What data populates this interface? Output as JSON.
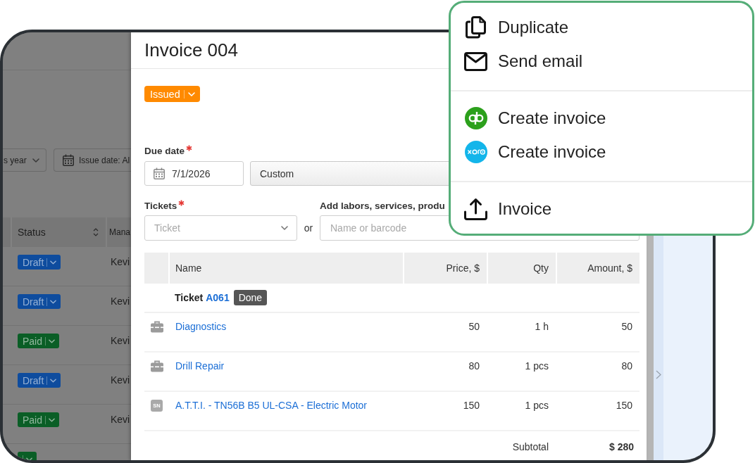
{
  "background_app": {
    "filters": [
      {
        "kind": "select",
        "label": "s year"
      },
      {
        "kind": "date",
        "label": "Issue date: Al"
      }
    ],
    "table": {
      "columns": [
        "Status",
        "Mana"
      ],
      "rows": [
        {
          "status": "Draft",
          "color": "#0e4c9e",
          "manager": "Kevi"
        },
        {
          "status": "Draft",
          "color": "#0e4c9e",
          "manager": "Kevi"
        },
        {
          "status": "Paid",
          "color": "#0a5e26",
          "manager": "Kevi"
        },
        {
          "status": "Draft",
          "color": "#0e4c9e",
          "manager": "Kevi"
        },
        {
          "status": "Paid",
          "color": "#0a5e26",
          "manager": "Kevi"
        },
        {
          "color": "#0a5e26"
        }
      ]
    }
  },
  "invoice": {
    "title": "Invoice 004",
    "status": "Issued",
    "due_date": {
      "label": "Due date",
      "required": true,
      "value": "7/1/2026",
      "term": "Custom"
    },
    "tickets": {
      "label": "Tickets",
      "required": true,
      "placeholder": "Ticket"
    },
    "separator": "or",
    "item_search": {
      "label": "Add labors, services, produ",
      "placeholder": "Name or barcode"
    },
    "table": {
      "columns": [
        "Name",
        "Price, $",
        "Qty",
        "Amount, $"
      ],
      "group": {
        "label": "Ticket",
        "number": "A061",
        "status": "Done"
      },
      "rows": [
        {
          "kind": "service",
          "name": "Diagnostics",
          "price": "50",
          "qty": "1 h",
          "amount": "50"
        },
        {
          "kind": "service",
          "name": "Drill Repair",
          "price": "80",
          "qty": "1 pcs",
          "amount": "80"
        },
        {
          "kind": "serial",
          "tag": "SN",
          "name": "A.T.T.I. - TN56B B5 UL-CSA - Electric Motor",
          "price": "150",
          "qty": "1 pcs",
          "amount": "150"
        }
      ],
      "subtotal": {
        "label": "Subtotal",
        "value": "$ 280"
      }
    }
  },
  "menu": {
    "sections": [
      {
        "items": [
          {
            "kind": "copy",
            "label": "Duplicate"
          },
          {
            "kind": "mail",
            "label": "Send email"
          }
        ]
      },
      {
        "items": [
          {
            "kind": "qb",
            "label": "Create invoice"
          },
          {
            "kind": "xero",
            "label": "Create invoice"
          }
        ]
      },
      {
        "items": [
          {
            "kind": "upload",
            "label": "Invoice"
          }
        ]
      }
    ]
  }
}
